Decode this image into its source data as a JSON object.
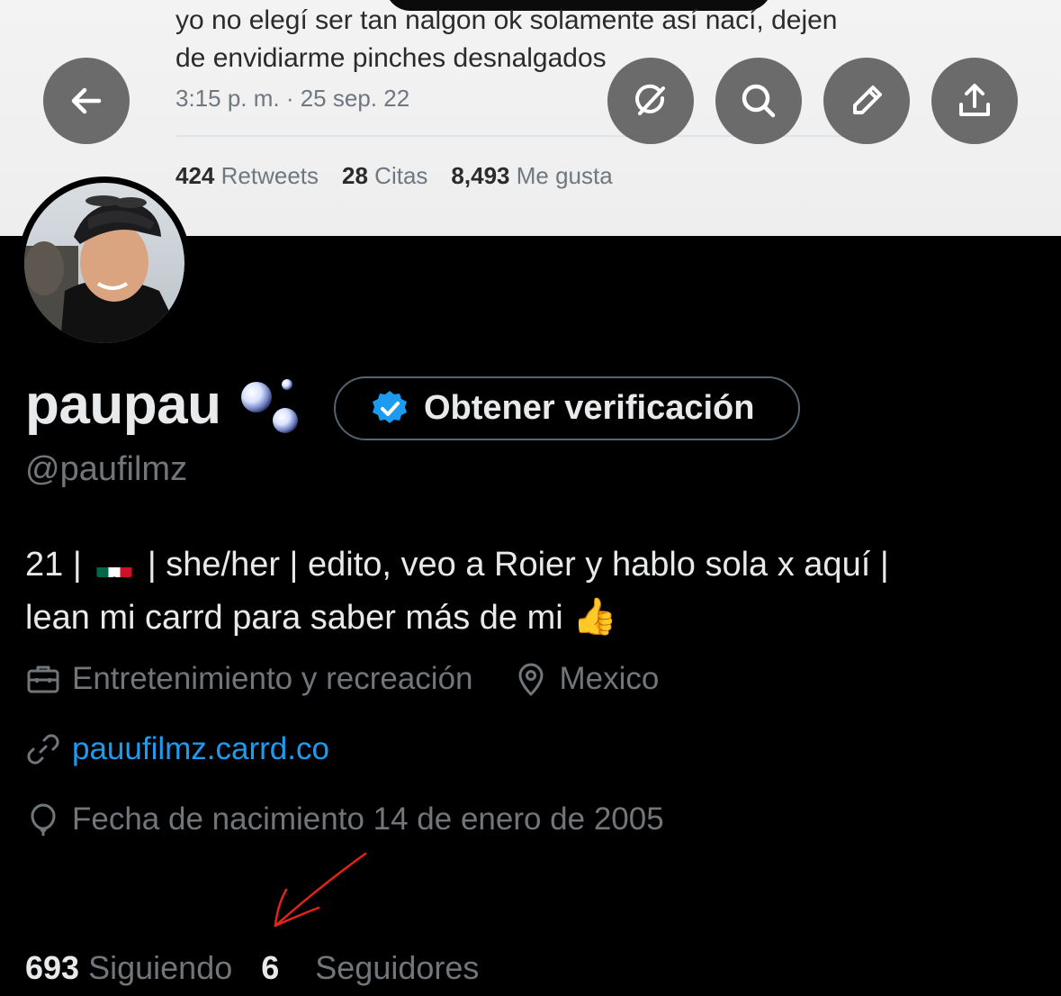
{
  "banner": {
    "tweet_line1": "yo no elegí ser tan nalgon ok solamente así nací, dejen",
    "tweet_line2": "de envidiarme pinches desnalgados",
    "tweet_time": "3:15 p. m. · 25 sep. 22",
    "stats": [
      {
        "count": "424",
        "label": "Retweets"
      },
      {
        "count": "28",
        "label": "Citas"
      },
      {
        "count": "8,493",
        "label": "Me gusta"
      }
    ]
  },
  "toolbar": {
    "icons": [
      "back-arrow-icon",
      "grok-icon",
      "search-icon",
      "edit-pencil-icon",
      "share-icon"
    ]
  },
  "profile": {
    "display_name": "paupau",
    "name_emoji": "bubbles",
    "verify_button_label": "Obtener verificación",
    "handle": "@paufilmz",
    "bio_part1": "21 | ",
    "bio_part2": " | she/her | edito, veo a Roier y hablo sola x aquí |",
    "bio_part3": "lean mi carrd para saber más de mi ",
    "bio_emoji": "👍",
    "category": "Entretenimiento y recreación",
    "location": "Mexico",
    "website": "pauufilmz.carrd.co",
    "birthday": "Fecha de nacimiento 14 de enero de 2005",
    "following_count": "693",
    "following_label": "Siguiendo",
    "followers_count": "6",
    "followers_label": "Seguidores"
  },
  "colors": {
    "background": "#000000",
    "primary_text": "#e7e9ea",
    "secondary_text": "#71767b",
    "link": "#1d9bf0",
    "annotation_arrow": "#e0241b"
  }
}
